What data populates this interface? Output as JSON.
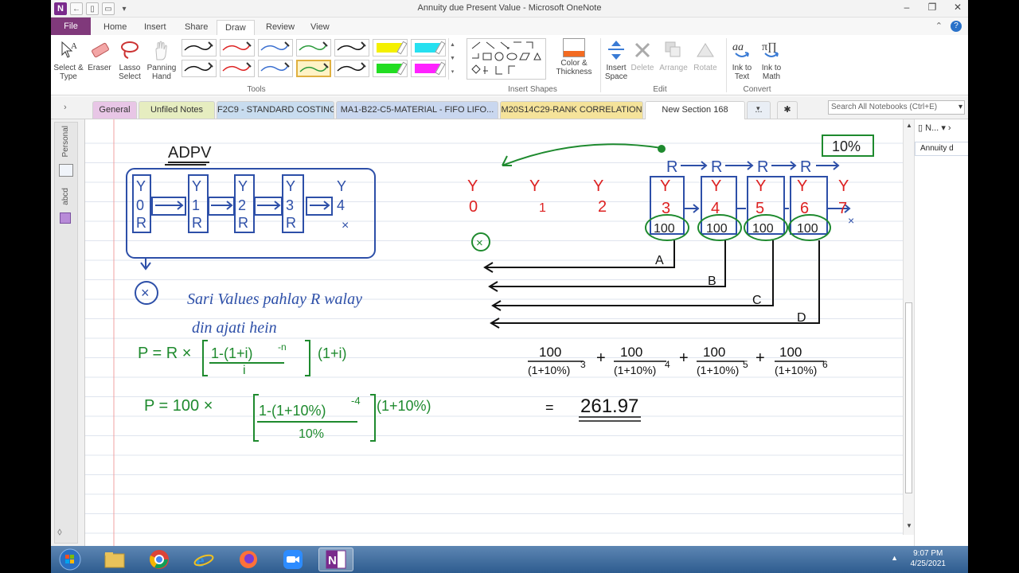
{
  "window": {
    "title": "Annuity due Present Value  -  Microsoft OneNote",
    "logo": "N",
    "minimize": "–",
    "restore": "❐",
    "close": "✕"
  },
  "menu": {
    "file": "File",
    "tabs": [
      "Home",
      "Insert",
      "Share",
      "Draw",
      "Review",
      "View"
    ],
    "active": "Draw",
    "collapse": "⌃",
    "help": "?"
  },
  "ribbon": {
    "tools": {
      "select": "Select & Type",
      "eraser": "Eraser",
      "lasso": "Lasso Select",
      "panning": "Panning Hand",
      "label": "Tools"
    },
    "pens": {
      "row1": [
        "#111111",
        "#d22",
        "#3a6fd0",
        "#2a9a3a",
        "#111111"
      ],
      "row2": [
        "#111111",
        "#d22",
        "#3a6fd0",
        "#2a9a3a",
        "#111111"
      ],
      "highlighters": [
        "#f4f000",
        "#25e0f0",
        "#22dd22",
        "#ff22ff"
      ]
    },
    "insert_shapes": {
      "color_thickness": "Color & Thickness",
      "label": "Insert Shapes"
    },
    "edit": {
      "insert_space": "Insert Space",
      "delete": "Delete",
      "arrange": "Arrange",
      "rotate": "Rotate",
      "label": "Edit"
    },
    "convert": {
      "ink_to_text": "Ink to Text",
      "ink_to_math": "Ink to Math",
      "label": "Convert"
    }
  },
  "sections": {
    "tabs": [
      {
        "label": "General",
        "color": "#e8c6e6"
      },
      {
        "label": "Unfiled Notes",
        "color": "#e6edc0"
      },
      {
        "label": "F2C9 - STANDARD COSTING",
        "color": "#c8dcef"
      },
      {
        "label": "MA1-B22-C5-MATERIAL - FIFO LIFO...",
        "color": "#c9d7ef"
      },
      {
        "label": "M20S14C29-RANK CORRELATION",
        "color": "#f5e39a"
      },
      {
        "label": "New Section 168",
        "color": "#ffffff"
      },
      {
        "label": "...",
        "color": "#e9eef5"
      }
    ],
    "search_placeholder": "Search All Notebooks (Ctrl+E)"
  },
  "nav": {
    "notebook1": "Personal",
    "notebook2": "abcd"
  },
  "pagelist": {
    "header": "N...",
    "item": "Annuity d"
  },
  "taskbar": {
    "time": "9:07 PM",
    "date": "4/25/2021"
  },
  "note": {
    "heading": "ADPV",
    "left_years": [
      "Y 0 R",
      "Y 1 R",
      "Y 2 R",
      "Y 3 R",
      "Y 4"
    ],
    "x_mark": "×",
    "sentence_line1": "Sari Values pahlay R walay",
    "sentence_line2": "din ajati hein",
    "formula1_lhs": "P = R ×",
    "formula1_num": "1-(1+i)",
    "formula1_exp": "-n",
    "formula1_den": "i",
    "formula1_tail": "(1+i)",
    "formula2_lhs": "P = 100 ×",
    "formula2_num": "1-(1+10%)",
    "formula2_exp": "-4",
    "formula2_den": "10%",
    "formula2_tail": "(1+10%)",
    "rate": "10%",
    "r_chain": [
      "R",
      "R",
      "R",
      "R"
    ],
    "years_left": [
      "0",
      "1",
      "2"
    ],
    "years_right": [
      "3",
      "4",
      "5",
      "6",
      "7"
    ],
    "year_header": "Y",
    "amount": "100",
    "arrow_labels": [
      "A",
      "B",
      "C",
      "D"
    ],
    "sum_terms": [
      {
        "num": "100",
        "den": "(1+10%)",
        "exp": "3"
      },
      {
        "num": "100",
        "den": "(1+10%)",
        "exp": "4"
      },
      {
        "num": "100",
        "den": "(1+10%)",
        "exp": "5"
      },
      {
        "num": "100",
        "den": "(1+10%)",
        "exp": "6"
      }
    ],
    "plus": "+",
    "equals": "=",
    "result": "261.97"
  }
}
